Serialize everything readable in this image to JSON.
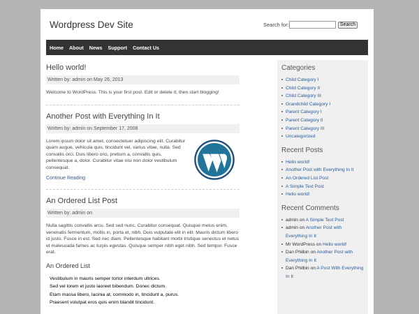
{
  "header": {
    "site_title": "Wordpress Dev Site",
    "search_label": "Search for:",
    "search_value": "",
    "search_button": "Search"
  },
  "nav": [
    "Home",
    "About",
    "News",
    "Support",
    "Contact Us"
  ],
  "posts": [
    {
      "title": "Hello world!",
      "byline": "Written by: admin on May 26, 2013",
      "excerpt": "Welcome to WordPress. This is your first post. Edit or delete it, then start blogging!"
    },
    {
      "title": "Another Post with Everything In It",
      "byline": "Written by: admin on September 17, 2008",
      "excerpt": "Lorem ipsum dolor sit amet, consectetuer adipiscing elit. Curabitur quam augue, vehicula quis, tincidunt vel, varius vitae, nulla. Sed convallis orci. Duis libero orci, pretium a, convallis quis, pellentesque a, dolor. Curabitur vitae nisi non dolor vestibulum consequat.",
      "more": "Continue Reading",
      "logo_icon": "wordpress-logo"
    },
    {
      "title": "An Ordered List Post",
      "byline": "Written by: admin on",
      "excerpt": "Nulla sagittis convallis arcu. Sed sed nunc. Curabitur consequat. Quisque metus enim, venenatis fermentum, mollis in, porta et, nibh. Duis vulputate elit in elit. Mauris dictum libero id justo. Fusce in est. Sed nec diam. Pellentesque habitant morbi tristique senectus et netus et malesuada fames ac turpis egestas. Quisque semper nibh eget nibh. Sed tempor. Fusce erat.",
      "subheading": "An Ordered List",
      "list": [
        "Vestibulum in mauris semper tortor interdum ultrices.",
        "Sed vel lorem et justo laoreet bibendum. Donec dictum.",
        "Etam massa libero, lacinia at, commodo in, tincidunt a, purus.",
        "Praesent volutpat eros quis enim blandit tincidunt."
      ]
    }
  ],
  "sidebar": {
    "categories_title": "Categories",
    "categories": [
      "Child Category I",
      "Child Category II",
      "Child Category III",
      "Grandchild Category I",
      "Parent Category I",
      "Parent Category II",
      "Parent Category III",
      "Uncategorized"
    ],
    "recent_posts_title": "Recent Posts",
    "recent_posts": [
      "Hello world!",
      "Another Post with Everything In It",
      "An Ordered List Post",
      "A Simple Text Post",
      "Hello world!"
    ],
    "recent_comments_title": "Recent Comments",
    "recent_comments": [
      {
        "author": "admin",
        "on": "on",
        "post": "A Simple Text Post"
      },
      {
        "author": "admin",
        "on": "on",
        "post": "Another Post with Everything In It"
      },
      {
        "author": "Mr WordPress",
        "on": "on",
        "post": "Hello world!"
      },
      {
        "author": "Dan Philbin",
        "on": "on",
        "post": "Another Post with Everything In It"
      },
      {
        "author": "Dan Philbin",
        "on": "on",
        "post": "A Post With Everything In It"
      }
    ]
  },
  "colors": {
    "nav_bg": "#333333",
    "link": "#2a5a9a",
    "sidebar_bg": "#f0f0f0",
    "logo_blue": "#21759b"
  }
}
